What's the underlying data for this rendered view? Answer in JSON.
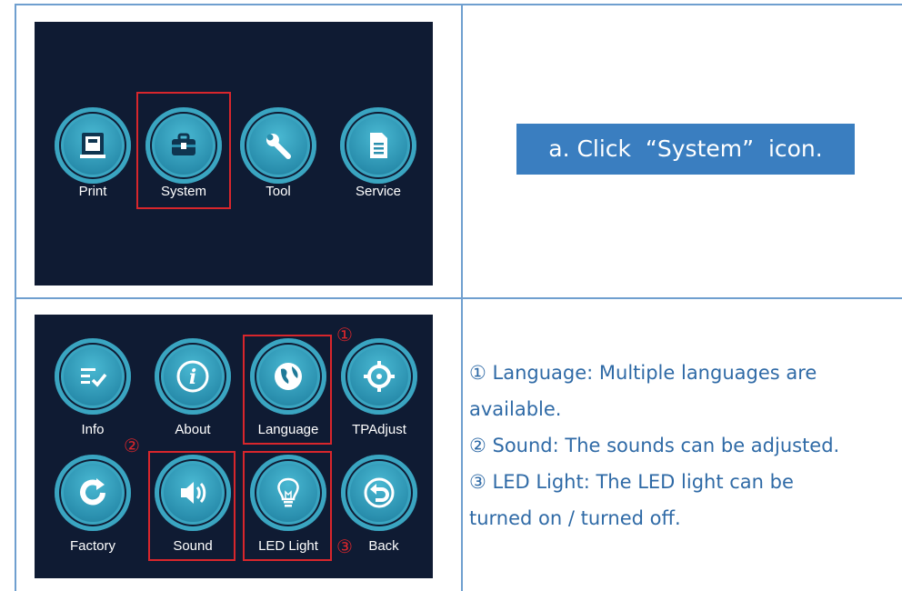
{
  "top_screen": {
    "icons": [
      {
        "name": "Print",
        "icon": "printer-icon"
      },
      {
        "name": "System",
        "icon": "toolbox-icon"
      },
      {
        "name": "Tool",
        "icon": "wrench-icon"
      },
      {
        "name": "Service",
        "icon": "document-icon"
      }
    ]
  },
  "step_a": "a. Click  “System”  icon.",
  "bottom_screen": {
    "icons": [
      {
        "name": "Info",
        "icon": "list-check-icon"
      },
      {
        "name": "About",
        "icon": "info-icon"
      },
      {
        "name": "Language",
        "icon": "globe-icon"
      },
      {
        "name": "TPAdjust",
        "icon": "crosshair-icon"
      },
      {
        "name": "Factory",
        "icon": "refresh-icon"
      },
      {
        "name": "Sound",
        "icon": "speaker-icon"
      },
      {
        "name": "LED Light",
        "icon": "lightbulb-icon"
      },
      {
        "name": "Back",
        "icon": "back-arrow-icon"
      }
    ],
    "markers": [
      "①",
      "②",
      "③"
    ]
  },
  "descriptions": [
    "① Language: Multiple languages are",
    "available.",
    "② Sound: The sounds can be adjusted.",
    "③ LED Light: The LED light can be",
    "turned on / turned off."
  ],
  "colors": {
    "screen_bg": "#0f1b33",
    "icon": "#3aa5c1",
    "highlight": "#d8262c",
    "banner": "#3a7ec0",
    "desc_text": "#2f6aa6",
    "table_line": "#6f9fcf"
  }
}
